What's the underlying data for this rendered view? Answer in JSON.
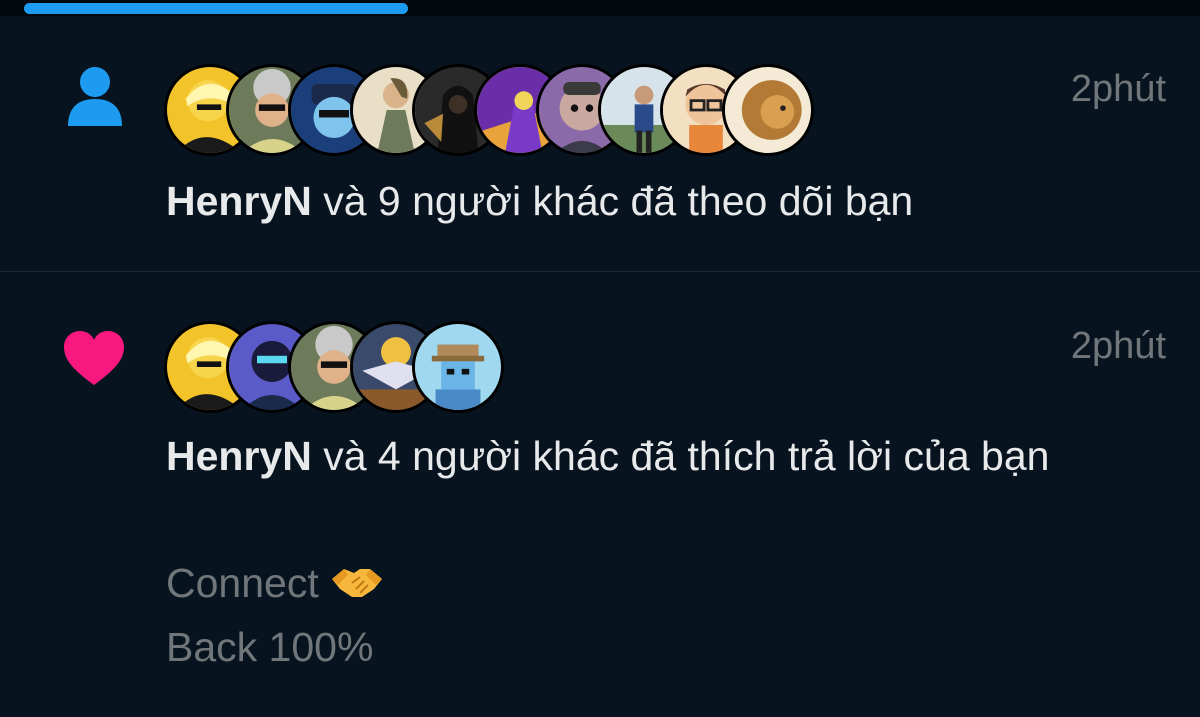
{
  "colors": {
    "background": "#07141f",
    "accent": "#1d9bf0",
    "like": "#f91880",
    "muted": "#71767b"
  },
  "progress": {
    "fraction": 0.32
  },
  "notifications": [
    {
      "type": "follow",
      "icon": "person-icon",
      "time": "2phút",
      "name": "HenryN",
      "text": " và 9 người khác đã theo dõi bạn",
      "avatars": [
        "avatar-1",
        "avatar-2",
        "avatar-3",
        "avatar-4",
        "avatar-5",
        "avatar-6",
        "avatar-7",
        "avatar-8",
        "avatar-9",
        "avatar-10"
      ]
    },
    {
      "type": "like",
      "icon": "heart-icon",
      "time": "2phút",
      "name": "HenryN",
      "text": " và 4 người khác đã thích trả lời của bạn",
      "quoted_lines": [
        "Connect",
        "Back 100%"
      ],
      "quoted_emoji": "handshake-icon",
      "avatars": [
        "avatar-1",
        "avatar-2",
        "avatar-3",
        "avatar-4",
        "avatar-5"
      ]
    }
  ]
}
